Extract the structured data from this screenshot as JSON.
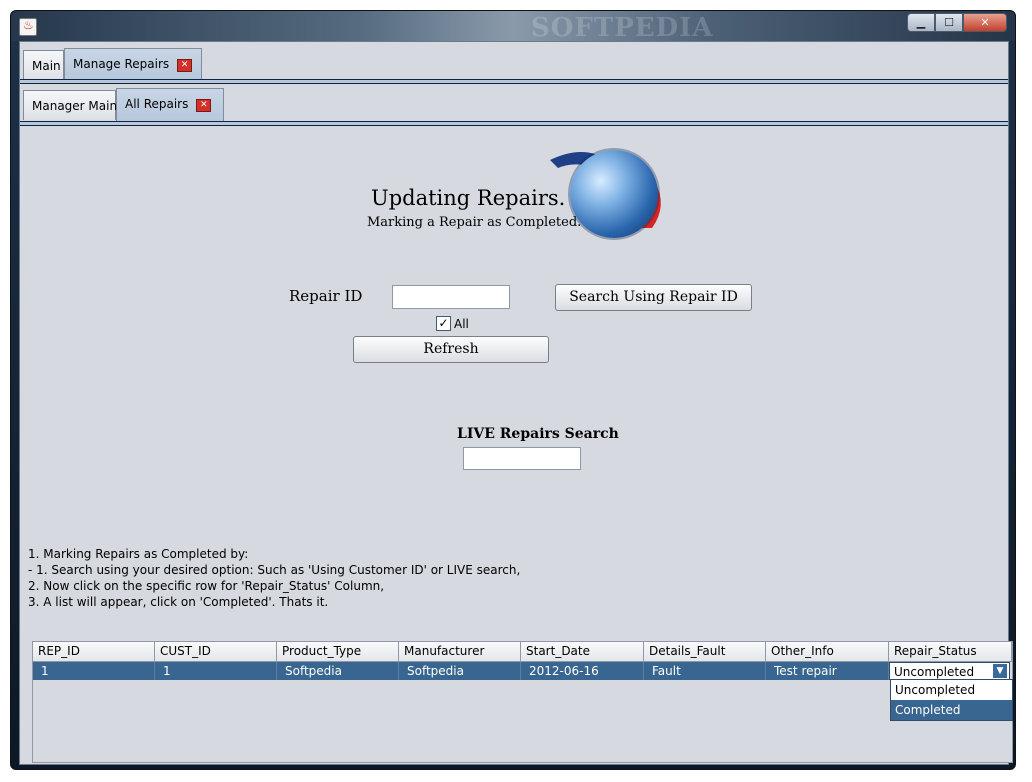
{
  "window": {
    "title_watermark": "SOFTPEDIA",
    "app_icon": "java-cup-icon",
    "controls": [
      "minimize-icon",
      "maximize-icon",
      "close-icon"
    ]
  },
  "outer_tabs": [
    {
      "label": "Main",
      "active": false
    },
    {
      "label": "Manage Repairs",
      "active": true,
      "closable": true
    }
  ],
  "inner_tabs": [
    {
      "label": "Manager Main",
      "active": false
    },
    {
      "label": "All Repairs",
      "active": true,
      "closable": true
    }
  ],
  "heading": "Updating Repairs.",
  "subheading": "Marking a Repair as Completed.",
  "logo_icon": "globe-icon",
  "repair_id_label": "Repair ID",
  "repair_id_value": "",
  "search_button_label": "Search Using Repair ID",
  "all_checkbox": {
    "label": "All",
    "checked": true
  },
  "refresh_button_label": "Refresh",
  "live_search": {
    "label": "LIVE Repairs Search",
    "value": ""
  },
  "instructions": [
    "1. Marking Repairs as Completed by:",
    "- 1. Search using your desired option: Such as 'Using Customer ID' or LIVE search,",
    "2. Now click on the specific row for 'Repair_Status' Column,",
    "3. A list will appear, click on 'Completed'. Thats it."
  ],
  "table": {
    "columns": [
      "REP_ID",
      "CUST_ID",
      "Product_Type",
      "Manufacturer",
      "Start_Date",
      "Details_Fault",
      "Other_Info",
      "Repair_Status"
    ],
    "rows": [
      [
        "1",
        "1",
        "Softpedia",
        "Softpedia",
        "2012-06-16",
        "Fault",
        "Test repair",
        "Uncompleted"
      ]
    ]
  },
  "status_dropdown": {
    "options": [
      "Uncompleted",
      "Completed"
    ],
    "highlighted": "Completed"
  },
  "colors": {
    "selection": "#386690",
    "panel": "#d6d9df",
    "tab_underline": "#0d2342"
  }
}
